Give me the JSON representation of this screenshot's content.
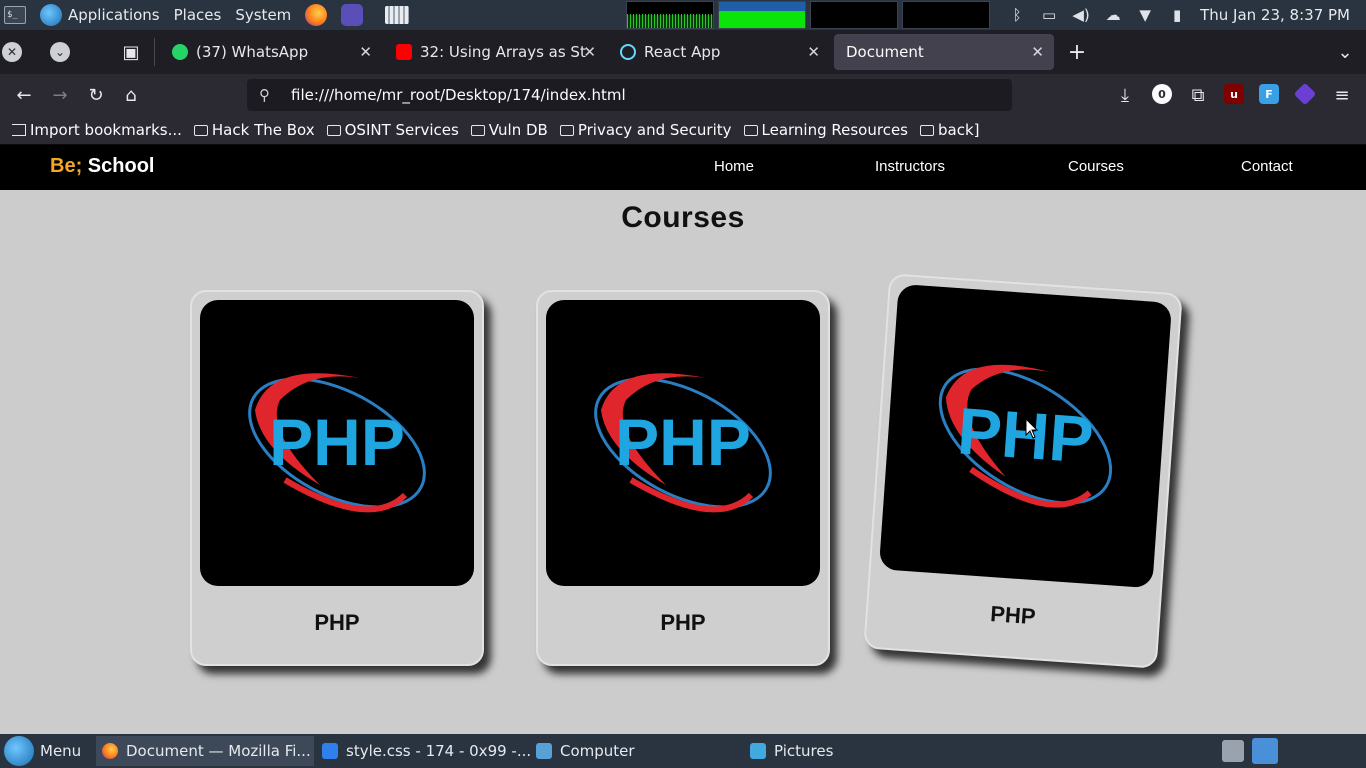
{
  "system_panel": {
    "menus": [
      "Applications",
      "Places",
      "System"
    ],
    "clock": "Thu Jan 23,  8:37 PM"
  },
  "tabs": [
    {
      "title": "(37) WhatsApp",
      "badge": "37"
    },
    {
      "title": "32: Using Arrays as St"
    },
    {
      "title": "React App"
    },
    {
      "title": "Document"
    }
  ],
  "url": "file:///home/mr_root/Desktop/174/index.html",
  "toolbar": {
    "notification_count": "0"
  },
  "bookmarks": [
    "Import bookmarks...",
    "Hack The Box",
    "OSINT Services",
    "Vuln DB",
    "Privacy and Security",
    "Learning Resources",
    "back]"
  ],
  "site": {
    "logo_accent": "Be;",
    "logo_main": "School",
    "nav": [
      "Home",
      "Instructors",
      "Courses",
      "Contact"
    ],
    "section_title": "Courses",
    "cards": [
      {
        "name": "PHP",
        "logo_text": "PHP"
      },
      {
        "name": "PHP",
        "logo_text": "PHP"
      },
      {
        "name": "PHP",
        "logo_text": "PHP"
      }
    ]
  },
  "taskbar": {
    "menu_label": "Menu",
    "tasks": [
      "Document — Mozilla Fi...",
      "style.css - 174 - 0x99 -...",
      "Computer",
      "Pictures"
    ]
  },
  "colors": {
    "logo_accent": "#f5a623",
    "php_blue": "#1fa6e0",
    "php_red": "#e0262c",
    "page_bg": "#cccccc"
  }
}
